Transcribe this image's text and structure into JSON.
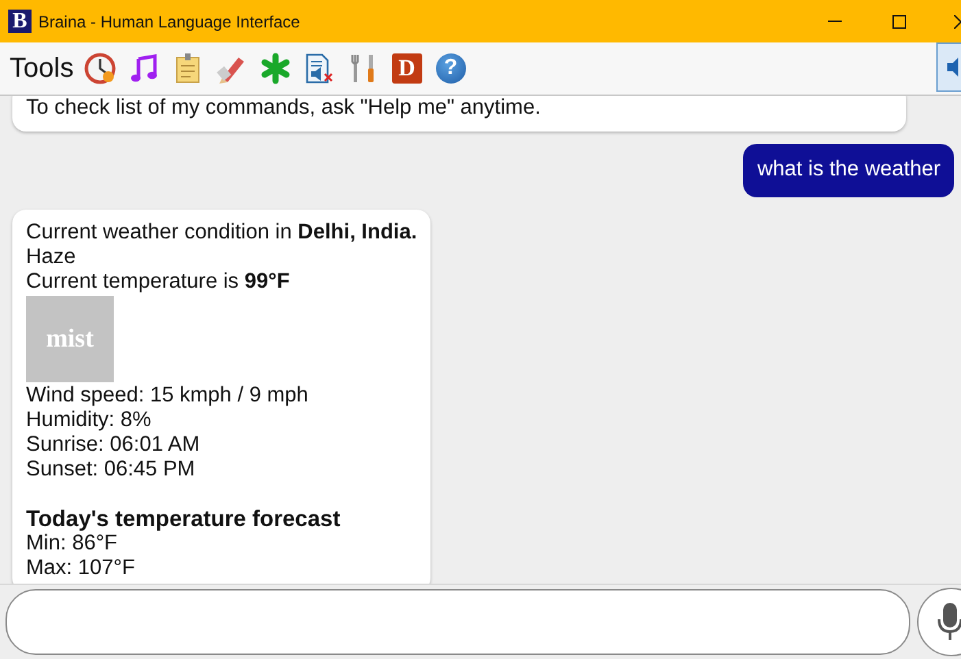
{
  "window": {
    "title": "Braina - Human Language Interface",
    "logo": "B"
  },
  "toolbar": {
    "label": "Tools",
    "items": [
      {
        "kind": "clock"
      },
      {
        "kind": "music"
      },
      {
        "kind": "notepad"
      },
      {
        "kind": "pencil"
      },
      {
        "kind": "asterisk"
      },
      {
        "kind": "mute-doc"
      },
      {
        "kind": "tools"
      },
      {
        "kind": "letter",
        "glyph": "D"
      },
      {
        "kind": "help",
        "glyph": "?"
      }
    ]
  },
  "chat": {
    "messages": [
      {
        "outgoing": false,
        "lines": [
          {
            "kind": "text",
            "text": "To check list of my commands, ask \"Help me\" anytime."
          }
        ]
      },
      {
        "outgoing": true,
        "lines": [
          {
            "kind": "text",
            "text": "what is the weather"
          }
        ]
      },
      {
        "outgoing": false,
        "lines": [
          {
            "kind": "text",
            "text": "Current weather condition in **Delhi, India.**"
          },
          {
            "kind": "text",
            "text": "Haze"
          },
          {
            "kind": "text",
            "text": "Current temperature is **99°F**"
          },
          {
            "kind": "image",
            "label": "mist"
          },
          {
            "kind": "text",
            "text": "Wind speed: 15 kmph / 9 mph"
          },
          {
            "kind": "text",
            "text": "Humidity: 8%"
          },
          {
            "kind": "text",
            "text": "Sunrise: 06:01 AM"
          },
          {
            "kind": "text",
            "text": "Sunset: 06:45 PM"
          },
          {
            "kind": "gap"
          },
          {
            "kind": "heading",
            "text": "Today's temperature forecast"
          },
          {
            "kind": "text",
            "text": "Min: 86°F"
          },
          {
            "kind": "text",
            "text": "Max: 107°F"
          }
        ]
      }
    ]
  }
}
